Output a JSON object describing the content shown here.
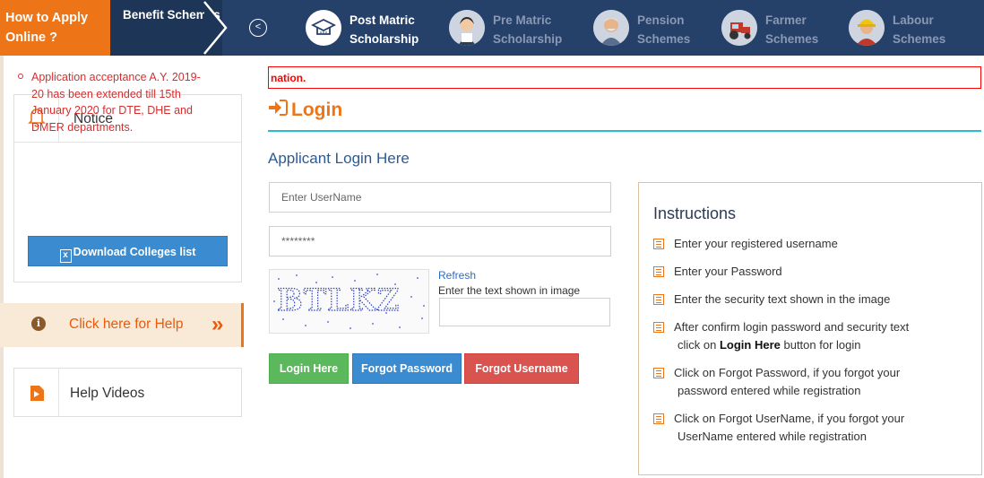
{
  "nav": {
    "how_to_apply": "How to Apply Online ?",
    "benefit_schemes": "Benefit Schemes",
    "schemes": [
      {
        "label1": "Post Matric",
        "label2": "Scholarship",
        "icon": "graduation-cap-icon",
        "active": true
      },
      {
        "label1": "Pre Matric",
        "label2": "Scholarship",
        "icon": "student-icon",
        "active": false
      },
      {
        "label1": "Pension",
        "label2": "Schemes",
        "icon": "elderly-man-icon",
        "active": false
      },
      {
        "label1": "Farmer",
        "label2": "Schemes",
        "icon": "tractor-icon",
        "active": false
      },
      {
        "label1": "Labour",
        "label2": "Schemes",
        "icon": "worker-helmet-icon",
        "active": false
      }
    ]
  },
  "sidebar": {
    "notice_title": "Notice",
    "notice_text": "Application acceptance A.Y. 2019-20 has been extended till 15th January 2020 for DTE, DHE and DMER departments.",
    "download_label": "Download Colleges list",
    "help_label": "Click here for Help",
    "help_arrow": "»",
    "videos_label": "Help Videos"
  },
  "main": {
    "error_text": "nation.",
    "login_title": "Login",
    "applicant_heading": "Applicant Login Here",
    "username_placeholder": "Enter UserName",
    "password_value": "********",
    "captcha_text": "BTLKZ",
    "refresh_label": "Refresh",
    "captcha_hint": "Enter the text shown in image",
    "buttons": {
      "login": "Login Here",
      "forgot_password": "Forgot Password",
      "forgot_username": "Forgot Username"
    }
  },
  "instructions": {
    "title": "Instructions",
    "items": [
      {
        "line1": "Enter your registered username"
      },
      {
        "line1": "Enter your Password"
      },
      {
        "line1": "Enter the security text shown in the image"
      },
      {
        "line1": "After confirm login password and security text",
        "pre": "click on ",
        "bold": "Login Here",
        "post": " button for login"
      },
      {
        "line1": "Click on Forgot Password, if you forgot your",
        "line2": "password entered while registration"
      },
      {
        "line1": "Click on Forgot UserName, if you forgot your",
        "line2": "UserName entered while registration"
      }
    ]
  },
  "colors": {
    "nav_bg": "#25416a",
    "orange": "#ee7418",
    "error_red": "#ff0000",
    "link_blue": "#2d6cc0",
    "teal_rule": "#27bcd0"
  }
}
